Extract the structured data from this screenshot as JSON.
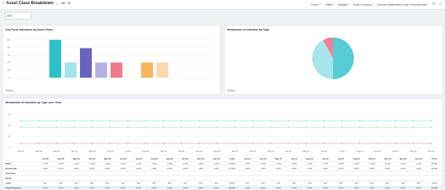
{
  "header": {
    "back_icon": "chevron-left-icon",
    "title": "Asset Class Breakdown",
    "title_icons": [
      "chevron-down-icon",
      "share-icon",
      "gear-icon"
    ],
    "filters": [
      {
        "label": "Fund-I"
      },
      {
        "label": "Office"
      },
      {
        "label": "Budget"
      },
      {
        "label": "Local Currency"
      },
      {
        "label": "Income Distribution to the Fund Amount"
      }
    ],
    "right_icons": [
      "edit-icon",
      "expand-icon"
    ]
  },
  "search": {
    "value": "GBI"
  },
  "bar_card": {
    "title": "Key Fund Indicators by Asset Class",
    "period_label": "FY20"
  },
  "pie_card": {
    "title": "Breakdown of Indicator by Type",
    "period_label": "FY20"
  },
  "line_card": {
    "title": "Breakdown of Indicator by Type over Time"
  },
  "chart_data": [
    {
      "type": "bar",
      "title": "Key Fund Indicators by Asset Class",
      "ytick_labels": [
        "100",
        "80",
        "60",
        "40",
        "20",
        "0"
      ],
      "ylim": [
        0,
        110
      ],
      "grid": true,
      "values": [
        100,
        40,
        78,
        40,
        40,
        0,
        40,
        40
      ],
      "colors": [
        "#2ec0c9",
        "#a3e3ea",
        "#6a63bd",
        "#b3b1e2",
        "#f07a8c",
        "#ffffff",
        "#f9b45c",
        "#fcd8b0"
      ]
    },
    {
      "type": "pie",
      "title": "Breakdown of Indicator by Type",
      "values": [
        50,
        42,
        8
      ],
      "colors": [
        "#56ccd6",
        "#a6e5ea",
        "#f08195"
      ]
    },
    {
      "type": "line",
      "title": "Breakdown of Indicator by Type over Time",
      "x": [
        "Jan 20",
        "Feb 20",
        "Mar 20",
        "Apr 20",
        "May 20",
        "Jun 20",
        "Jul 20",
        "Aug 20",
        "Sep 20",
        "Oct 20",
        "Nov 20",
        "Dec 20",
        "Jan 21",
        "Feb 21",
        "Mar 21",
        "Apr 21",
        "May 21",
        "Jun 21",
        "Jul 21",
        "Aug 21",
        "Sep 21",
        "Oct 21",
        "Nov 21",
        "Dec 21"
      ],
      "ytick_labels": [
        "75",
        "50",
        "25",
        "0"
      ],
      "ylim": [
        0,
        80
      ],
      "grid": true,
      "series": [
        {
          "values": [
            60,
            60,
            60,
            60,
            60,
            60,
            60,
            60,
            60,
            60,
            60,
            60,
            60,
            60,
            60,
            60,
            60,
            60,
            60,
            60,
            60,
            60,
            60,
            60
          ],
          "color": "#5fd1d8"
        },
        {
          "values": [
            46,
            46,
            46,
            46,
            46,
            46,
            46,
            46,
            46,
            46,
            46,
            46,
            46,
            46,
            46,
            46,
            46,
            46,
            46,
            46,
            46,
            46,
            46,
            46
          ],
          "color": "#8fd3a0"
        },
        {
          "values": [
            8,
            8,
            8,
            8,
            8,
            8,
            8,
            8,
            8,
            8,
            8,
            8,
            8,
            8,
            8,
            8,
            8,
            8,
            8,
            8,
            8,
            8,
            8,
            8
          ],
          "color": "#f07a8c"
        }
      ]
    }
  ],
  "table": {
    "columns": [
      "",
      "Jan 20",
      "Feb 20",
      "Mar 20",
      "Apr 20",
      "May 20",
      "Jun 20",
      "Jul 20",
      "Aug 20",
      "Sep 20",
      "Oct 20",
      "Nov 20",
      "Dec 20",
      "FY20",
      "Jan 21",
      "Feb 21",
      "Mar 21",
      "Apr 21",
      "May 21",
      "Jun 21",
      "Jul 21",
      "Aug 21",
      "Sep 21",
      "Oct 21",
      "Nov 21",
      "Dec 21",
      "FY21"
    ],
    "rows": [
      {
        "label": "Office",
        "cells": [
          "3,333",
          "3,333",
          "3,333",
          "3,333",
          "3,333",
          "3,333",
          "3,333",
          "3,333",
          "3,333",
          "3,333",
          "3,333",
          "3,333",
          "40,000",
          "3,333",
          "3,333",
          "3,333",
          "3,333",
          "3,333",
          "3,333",
          "3,333",
          "3,333",
          "3,333",
          "3,333",
          "3,333",
          "3,333",
          "40,000"
        ]
      },
      {
        "label": "Residential",
        "cells": [
          "2,667",
          "2,667",
          "2,667",
          "2,667",
          "2,667",
          "2,667",
          "2,667",
          "2,667",
          "2,667",
          "2,667",
          "2,667",
          "2,667",
          "32,000",
          "2,667",
          "2,667",
          "2,667",
          "2,667",
          "2,667",
          "2,667",
          "2,667",
          "2,667",
          "2,667",
          "2,667",
          "2,667",
          "2,667",
          "32,000"
        ]
      },
      {
        "label": "Industrial",
        "cells": [
          "",
          "",
          "",
          "",
          "",
          "",
          "",
          "",
          "",
          "",
          "",
          "",
          "",
          "",
          "",
          "",
          "",
          "",
          "",
          "",
          "",
          "",
          "",
          "",
          "",
          ""
        ]
      },
      {
        "label": "Retail",
        "cells": [
          "",
          "",
          "",
          "",
          "",
          "",
          "",
          "",
          "",
          "",
          "",
          "",
          "",
          "",
          "",
          "",
          "",
          "",
          "",
          "",
          "",
          "",
          "",
          "",
          "",
          ""
        ]
      },
      {
        "label": "Land",
        "cells": [
          "667",
          "667",
          "667",
          "667",
          "667",
          "667",
          "667",
          "667",
          "667",
          "667",
          "667",
          "667",
          "8,000",
          "667",
          "667",
          "667",
          "667",
          "667",
          "667",
          "667",
          "667",
          "667",
          "667",
          "667",
          "667",
          "8,000"
        ]
      },
      {
        "label": "Total Properties",
        "cells": [
          "6,667",
          "6,667",
          "6,667",
          "6,667",
          "6,667",
          "6,667",
          "6,667",
          "6,667",
          "6,667",
          "6,667",
          "6,667",
          "6,667",
          "80,000",
          "6,667",
          "6,667",
          "6,667",
          "6,667",
          "6,667",
          "6,667",
          "6,667",
          "6,667",
          "6,667",
          "6,667",
          "6,667",
          "6,667",
          "80,000"
        ]
      }
    ]
  }
}
